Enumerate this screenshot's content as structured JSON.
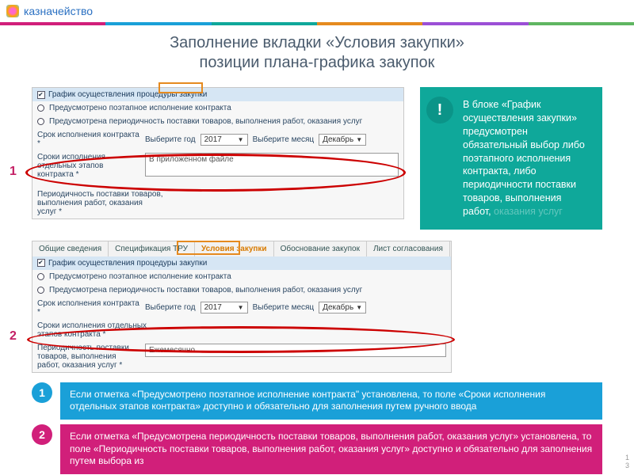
{
  "header": {
    "brand": "казначейство"
  },
  "stripes": [
    "#d11f7a",
    "#1aa0d8",
    "#0fa89a",
    "#e58a1f",
    "#9b4fd6",
    "#5fb661"
  ],
  "title": {
    "l1": "Заполнение вкладки «Условия закупки»",
    "l2": "позиции плана-графика закупок"
  },
  "shot1": {
    "hdr": "График осуществления процедуры закупки",
    "opt1": "Предусмотрено поэтапное исполнение контракта",
    "opt2": "Предусмотрена периодичность поставки товаров, выполнения работ, оказания услуг",
    "term_lbl": "Срок исполнения контракта *",
    "year_lbl": "Выберите год",
    "year_val": "2017",
    "month_lbl": "Выберите месяц",
    "month_val": "Декабрь",
    "stages_lbl": "Сроки исполнения отдельных этапов контракта *",
    "stages_val": "В приложенном файле",
    "period_lbl": "Периодичность поставки товаров, выполнения работ, оказания услуг *"
  },
  "shot2": {
    "tabs": [
      "Общие сведения",
      "Спецификация ТРУ",
      "Условия закупки",
      "Обоснование закупок",
      "Лист согласования"
    ],
    "period_val": "Ежемесячно"
  },
  "markers": {
    "m1": "1",
    "m2": "2"
  },
  "info": {
    "mark": "!",
    "text": "В блоке «График осуществления закупки» предусмотрен обязательный выбор либо поэтапного исполнения контракта, либо периодичности поставки товаров, выполнения работ,",
    "fade": "оказания услуг"
  },
  "note1": {
    "num": "1",
    "text": "Если отметка «Предусмотрено поэтапное исполнение контракта\" установлена, то поле «Сроки исполнения отдельных этапов контракта» доступно и обязательно для заполнения путем ручного ввода"
  },
  "note2": {
    "num": "2",
    "text": "Если отметка «Предусмотрена периодичность поставки товаров, выполнения работ, оказания услуг» установлена, то поле «Периодичность поставки товаров, выполнения работ, оказания услуг» доступно и обязательно для заполнения путем выбора из"
  },
  "slidenum": {
    "a": "1",
    "b": "3"
  }
}
